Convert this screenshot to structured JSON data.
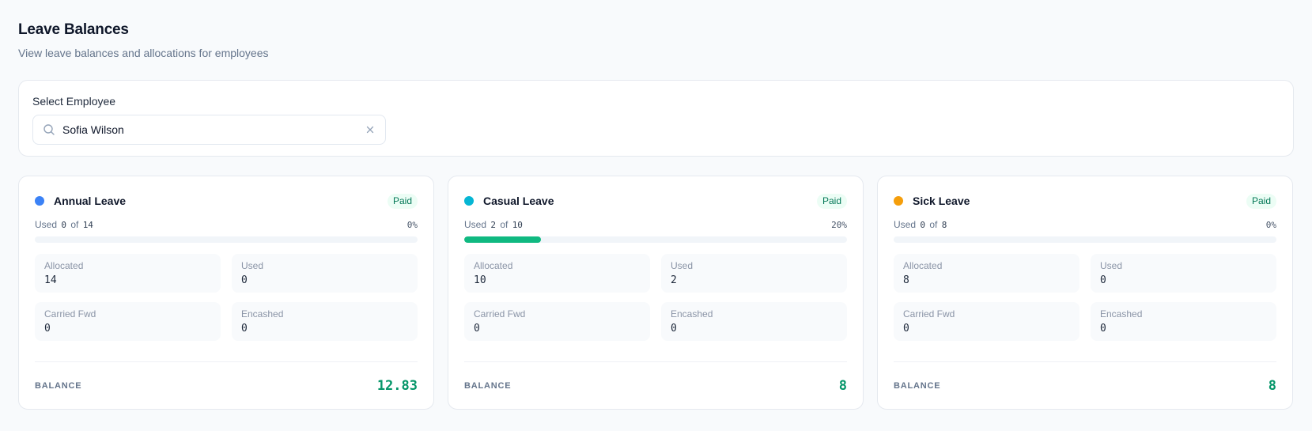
{
  "header": {
    "title": "Leave Balances",
    "subtitle": "View leave balances and allocations for employees"
  },
  "employee_select": {
    "label": "Select Employee",
    "value": "Sofia Wilson",
    "icons": {
      "search": "search-icon",
      "clear": "close-icon"
    }
  },
  "labels": {
    "used_prefix": "Used",
    "of": "of",
    "allocated": "Allocated",
    "used": "Used",
    "carried_fwd": "Carried Fwd",
    "encashed": "Encashed",
    "balance": "BALANCE"
  },
  "leave_types": [
    {
      "name": "Annual Leave",
      "color": "#3b82f6",
      "badge": "Paid",
      "used": "0",
      "total": "14",
      "percent_label": "0%",
      "progress": 0,
      "allocated": "14",
      "used_value": "0",
      "carried_fwd": "0",
      "encashed": "0",
      "balance": "12.83"
    },
    {
      "name": "Casual Leave",
      "color": "#06b6d4",
      "badge": "Paid",
      "used": "2",
      "total": "10",
      "percent_label": "20%",
      "progress": 20,
      "allocated": "10",
      "used_value": "2",
      "carried_fwd": "0",
      "encashed": "0",
      "balance": "8"
    },
    {
      "name": "Sick Leave",
      "color": "#f59e0b",
      "badge": "Paid",
      "used": "0",
      "total": "8",
      "percent_label": "0%",
      "progress": 0,
      "allocated": "8",
      "used_value": "0",
      "carried_fwd": "0",
      "encashed": "0",
      "balance": "8"
    }
  ],
  "colors": {
    "progress_fill": "#10b981",
    "balance": "#059669",
    "badge_text": "#047857",
    "badge_bg": "#ecfdf5"
  }
}
